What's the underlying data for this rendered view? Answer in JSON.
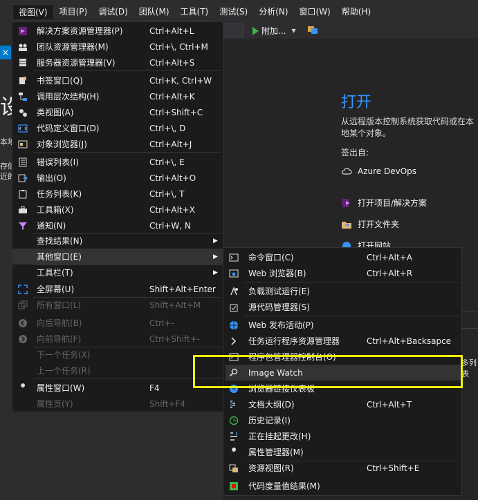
{
  "menubar": {
    "items": [
      "视图(V)",
      "项目(P)",
      "调试(D)",
      "团队(M)",
      "工具(T)",
      "测试(S)",
      "分析(N)",
      "窗口(W)",
      "帮助(H)"
    ]
  },
  "toolbar": {
    "attach_label": "附加...",
    "left_tab_close": "×"
  },
  "background_left": {
    "big_char": "设",
    "line1": "本地",
    "line2": "存储",
    "line3": "近的"
  },
  "start_page": {
    "title": "打开",
    "description": "从远程版本控制系统获取代码或在本地某个对象。",
    "sign_in_label": "签出自:",
    "azure_label": "Azure DevOps",
    "open_project_label": "打开项目/解决方案",
    "open_folder_label": "打开文件夹",
    "open_website_label": "打开网站",
    "side_text": "多列表"
  },
  "view_menu": {
    "items": [
      {
        "label": "解决方案资源管理器(P)",
        "shortcut": "Ctrl+Alt+L",
        "icon": "solution-explorer-icon"
      },
      {
        "label": "团队资源管理器(M)",
        "shortcut": "Ctrl+\\, Ctrl+M",
        "icon": "team-explorer-icon"
      },
      {
        "label": "服务器资源管理器(V)",
        "shortcut": "Ctrl+Alt+S",
        "icon": "server-explorer-icon"
      },
      {
        "label": "书签窗口(Q)",
        "shortcut": "Ctrl+K, Ctrl+W",
        "icon": "bookmark-icon"
      },
      {
        "label": "调用层次结构(H)",
        "shortcut": "Ctrl+Alt+K",
        "icon": "call-hierarchy-icon"
      },
      {
        "label": "类视图(A)",
        "shortcut": "Ctrl+Shift+C",
        "icon": "class-view-icon"
      },
      {
        "label": "代码定义窗口(D)",
        "shortcut": "Ctrl+\\, D",
        "icon": "code-definition-icon"
      },
      {
        "label": "对象浏览器(J)",
        "shortcut": "Ctrl+Alt+J",
        "icon": "object-browser-icon"
      },
      {
        "label": "错误列表(I)",
        "shortcut": "Ctrl+\\, E",
        "icon": "error-list-icon"
      },
      {
        "label": "输出(O)",
        "shortcut": "Ctrl+Alt+O",
        "icon": "output-icon"
      },
      {
        "label": "任务列表(K)",
        "shortcut": "Ctrl+\\, T",
        "icon": "task-list-icon"
      },
      {
        "label": "工具箱(X)",
        "shortcut": "Ctrl+Alt+X",
        "icon": "toolbox-icon"
      },
      {
        "label": "通知(N)",
        "shortcut": "Ctrl+W, N",
        "icon": "notification-icon"
      },
      {
        "label": "查找结果(N)",
        "shortcut": "",
        "icon": ""
      },
      {
        "label": "其他窗口(E)",
        "shortcut": "",
        "icon": ""
      },
      {
        "label": "工具栏(T)",
        "shortcut": "",
        "icon": ""
      },
      {
        "label": "全屏幕(U)",
        "shortcut": "Shift+Alt+Enter",
        "icon": "fullscreen-icon"
      },
      {
        "label": "所有窗口(L)",
        "shortcut": "Shift+Alt+M",
        "icon": "all-windows-icon"
      },
      {
        "label": "向后导航(B)",
        "shortcut": "Ctrl+-",
        "icon": "navigate-back-icon"
      },
      {
        "label": "向前导航(F)",
        "shortcut": "Ctrl+Shift+-",
        "icon": "navigate-forward-icon"
      },
      {
        "label": "下一个任务(X)",
        "shortcut": "",
        "icon": ""
      },
      {
        "label": "上一个任务(R)",
        "shortcut": "",
        "icon": ""
      },
      {
        "label": "属性窗口(W)",
        "shortcut": "F4",
        "icon": "properties-wrench-icon"
      },
      {
        "label": "属性页(Y)",
        "shortcut": "Shift+F4",
        "icon": ""
      }
    ],
    "submenu_arrow": "▶"
  },
  "other_windows_menu": {
    "items": [
      {
        "label": "命令窗口(C)",
        "shortcut": "Ctrl+Alt+A",
        "icon": "command-window-icon"
      },
      {
        "label": "Web 浏览器(B)",
        "shortcut": "Ctrl+Alt+R",
        "icon": "web-browser-icon"
      },
      {
        "label": "负载测试运行(E)",
        "shortcut": "",
        "icon": "load-test-icon"
      },
      {
        "label": "源代码管理器(S)",
        "shortcut": "",
        "icon": "source-control-icon"
      },
      {
        "label": "Web 发布活动(P)",
        "shortcut": "",
        "icon": "web-publish-icon"
      },
      {
        "label": "任务运行程序资源管理器",
        "shortcut": "Ctrl+Alt+Backsapce",
        "icon": "task-runner-icon"
      },
      {
        "label": "程序包管理器控制台(O)",
        "shortcut": "",
        "icon": "package-manager-icon"
      },
      {
        "label": "Image Watch",
        "shortcut": "",
        "icon": "magnifier-icon"
      },
      {
        "label": "浏览器链接仪表板",
        "shortcut": "",
        "icon": "browser-link-icon"
      },
      {
        "label": "文档大纲(D)",
        "shortcut": "Ctrl+Alt+T",
        "icon": "document-outline-icon"
      },
      {
        "label": "历史记录(I)",
        "shortcut": "",
        "icon": "history-icon"
      },
      {
        "label": "正在挂起更改(H)",
        "shortcut": "",
        "icon": "pending-changes-icon"
      },
      {
        "label": "属性管理器(M)",
        "shortcut": "",
        "icon": "property-manager-icon"
      },
      {
        "label": "资源视图(R)",
        "shortcut": "Ctrl+Shift+E",
        "icon": "resource-view-icon"
      },
      {
        "label": "代码度量值结果(M)",
        "shortcut": "",
        "icon": "code-metrics-icon"
      }
    ]
  }
}
